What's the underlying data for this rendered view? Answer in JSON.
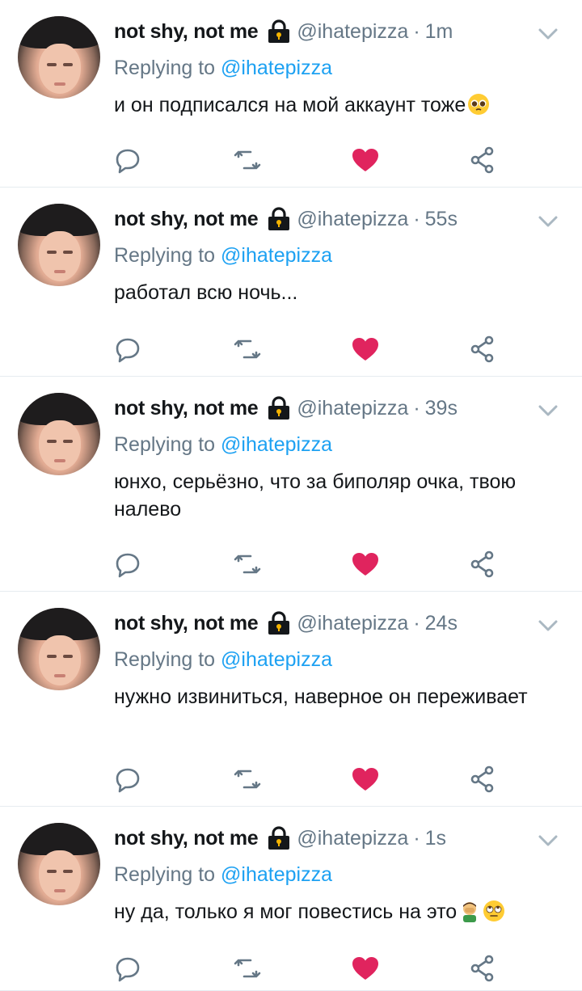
{
  "colors": {
    "text": "#14171a",
    "muted": "#657786",
    "link": "#1da1f2",
    "like": "#e0245e",
    "divider": "#e6ecf0"
  },
  "icons": {
    "avatar": "profile-photo",
    "lock": "lock-icon",
    "chevron": "chevron-down-icon",
    "reply": "reply-icon",
    "retweet": "retweet-icon",
    "like": "heart-icon",
    "share": "share-icon"
  },
  "tweets": [
    {
      "name": "not shy, not me",
      "handle": "@ihatepizza",
      "separator": "·",
      "time": "1m",
      "replying_prefix": "Replying to",
      "replying_to": "@ihatepizza",
      "text": "и он подписался на мой аккаунт тоже",
      "emojis": [
        "pleading-face-emoji"
      ],
      "liked": true
    },
    {
      "name": "not shy, not me",
      "handle": "@ihatepizza",
      "separator": "·",
      "time": "55s",
      "replying_prefix": "Replying to",
      "replying_to": "@ihatepizza",
      "text": "работал всю ночь...",
      "emojis": [],
      "liked": true
    },
    {
      "name": "not shy, not me",
      "handle": "@ihatepizza",
      "separator": "·",
      "time": "39s",
      "replying_prefix": "Replying to",
      "replying_to": "@ihatepizza",
      "text": "юнхо, серьёзно, что за биполяр очка, твою налево",
      "emojis": [],
      "liked": true
    },
    {
      "name": "not shy, not me",
      "handle": "@ihatepizza",
      "separator": "·",
      "time": "24s",
      "replying_prefix": "Replying to",
      "replying_to": "@ihatepizza",
      "text": "нужно извиниться, наверное он переживает",
      "emojis": [],
      "liked": true
    },
    {
      "name": "not shy, not me",
      "handle": "@ihatepizza",
      "separator": "·",
      "time": "1s",
      "replying_prefix": "Replying to",
      "replying_to": "@ihatepizza",
      "text": "ну да, только я мог повестись на это",
      "emojis": [
        "man-facepalming-emoji",
        "face-with-rolling-eyes-emoji"
      ],
      "liked": true
    }
  ]
}
